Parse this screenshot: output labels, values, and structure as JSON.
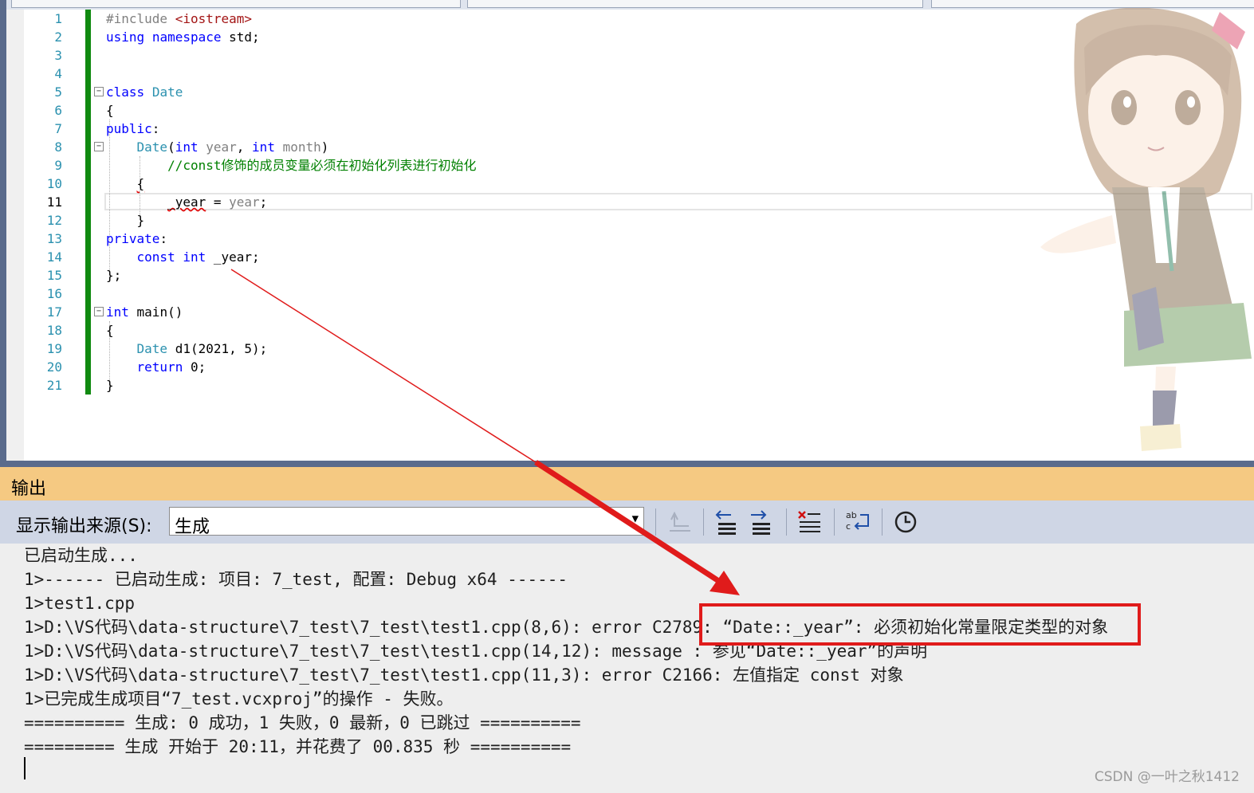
{
  "editor": {
    "line_numbers": [
      "1",
      "2",
      "3",
      "4",
      "5",
      "6",
      "7",
      "8",
      "9",
      "10",
      "11",
      "12",
      "13",
      "14",
      "15",
      "16",
      "17",
      "18",
      "19",
      "20",
      "21"
    ],
    "code_lines": [
      [
        {
          "t": "#include ",
          "c": "pp"
        },
        {
          "t": "<iostream>",
          "c": "str"
        }
      ],
      [
        {
          "t": "using",
          "c": "kw"
        },
        {
          "t": " ",
          "c": "nu"
        },
        {
          "t": "namespace",
          "c": "kw"
        },
        {
          "t": " std;",
          "c": "nu"
        }
      ],
      [],
      [],
      [
        {
          "t": "class",
          "c": "kw"
        },
        {
          "t": " ",
          "c": "nu"
        },
        {
          "t": "Date",
          "c": "ty"
        }
      ],
      [
        {
          "t": "{",
          "c": "nu"
        }
      ],
      [
        {
          "t": "public",
          "c": "kw"
        },
        {
          "t": ":",
          "c": "nu"
        }
      ],
      [
        {
          "t": "    ",
          "c": "nu"
        },
        {
          "t": "Date",
          "c": "ty"
        },
        {
          "t": "(",
          "c": "nu"
        },
        {
          "t": "int",
          "c": "kw"
        },
        {
          "t": " ",
          "c": "nu"
        },
        {
          "t": "year",
          "c": "pa"
        },
        {
          "t": ", ",
          "c": "nu"
        },
        {
          "t": "int",
          "c": "kw"
        },
        {
          "t": " ",
          "c": "nu"
        },
        {
          "t": "month",
          "c": "pa"
        },
        {
          "t": ")",
          "c": "nu"
        }
      ],
      [
        {
          "t": "        ",
          "c": "nu"
        },
        {
          "t": "//const修饰的成员变量必须在初始化列表进行初始化",
          "c": "cm"
        }
      ],
      [
        {
          "t": "    ",
          "c": "nu"
        },
        {
          "t": "{",
          "c": "nu",
          "sq": true
        }
      ],
      [
        {
          "t": "        ",
          "c": "nu"
        },
        {
          "t": "_year",
          "c": "nu",
          "sq": true
        },
        {
          "t": " = ",
          "c": "nu"
        },
        {
          "t": "year",
          "c": "pa"
        },
        {
          "t": ";",
          "c": "nu"
        }
      ],
      [
        {
          "t": "    }",
          "c": "nu"
        }
      ],
      [
        {
          "t": "private",
          "c": "kw"
        },
        {
          "t": ":",
          "c": "nu"
        }
      ],
      [
        {
          "t": "    ",
          "c": "nu"
        },
        {
          "t": "const",
          "c": "kw"
        },
        {
          "t": " ",
          "c": "nu"
        },
        {
          "t": "int",
          "c": "kw"
        },
        {
          "t": " _year;",
          "c": "nu"
        }
      ],
      [
        {
          "t": "};",
          "c": "nu"
        }
      ],
      [],
      [
        {
          "t": "int",
          "c": "kw"
        },
        {
          "t": " main()",
          "c": "nu"
        }
      ],
      [
        {
          "t": "{",
          "c": "nu"
        }
      ],
      [
        {
          "t": "    ",
          "c": "nu"
        },
        {
          "t": "Date",
          "c": "ty"
        },
        {
          "t": " d1(2021, 5);",
          "c": "nu"
        }
      ],
      [
        {
          "t": "    ",
          "c": "nu"
        },
        {
          "t": "return",
          "c": "kw"
        },
        {
          "t": " 0;",
          "c": "nu"
        }
      ],
      [
        {
          "t": "}",
          "c": "nu"
        }
      ]
    ]
  },
  "output_panel": {
    "title": "输出",
    "source_label": "显示输出来源(S):",
    "source_value": "生成",
    "lines": [
      "已启动生成...",
      "1>------ 已启动生成: 项目: 7_test, 配置: Debug x64 ------",
      "1>test1.cpp",
      "1>D:\\VS代码\\data-structure\\7_test\\7_test\\test1.cpp(8,6): error C2789: “Date::_year”: 必须初始化常量限定类型的对象",
      "1>D:\\VS代码\\data-structure\\7_test\\7_test\\test1.cpp(14,12): message : 参见“Date::_year”的声明",
      "1>D:\\VS代码\\data-structure\\7_test\\7_test\\test1.cpp(11,3): error C2166: 左值指定 const 对象",
      "1>已完成生成项目“7_test.vcxproj”的操作 - 失败。",
      "========== 生成: 0 成功，1 失败，0 最新，0 已跳过 ==========",
      "========= 生成 开始于 20:11，并花费了 00.835 秒 =========="
    ]
  },
  "watermark": "CSDN @一叶之秋1412",
  "colors": {
    "keyword": "#0000ff",
    "type": "#2b91af",
    "comment": "#008000",
    "annotation": "#e01b1b"
  }
}
